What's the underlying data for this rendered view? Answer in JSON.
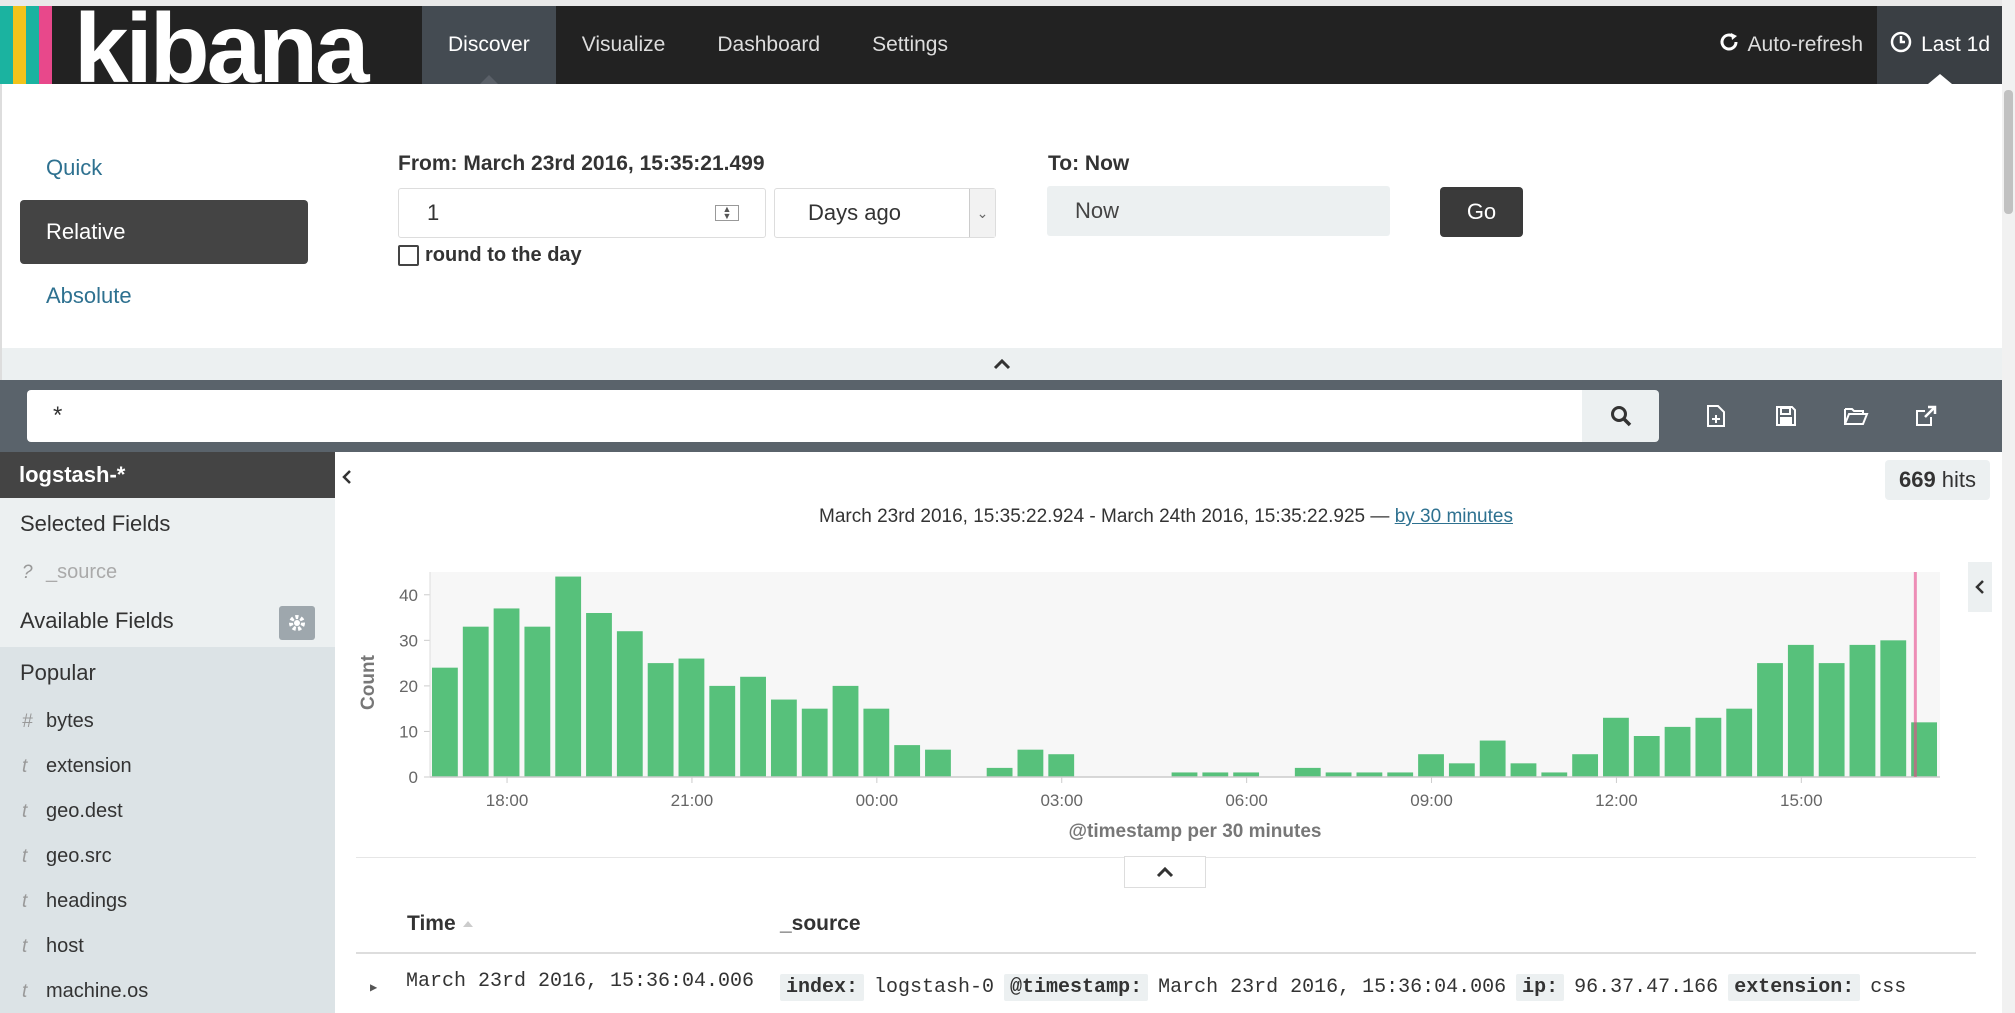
{
  "app": {
    "logo_text": "kibana",
    "logo_colors": [
      "#e8488b",
      "#f2c31a",
      "#1bb3a0",
      "#3ebeb0"
    ]
  },
  "nav": {
    "tabs": [
      {
        "label": "Discover",
        "active": true
      },
      {
        "label": "Visualize",
        "active": false
      },
      {
        "label": "Dashboard",
        "active": false
      },
      {
        "label": "Settings",
        "active": false
      }
    ],
    "auto_refresh": "Auto-refresh",
    "time_label": "Last 1d"
  },
  "timepicker": {
    "modes": [
      "Quick",
      "Relative",
      "Absolute"
    ],
    "active_mode": "Relative",
    "from_label": "From: March 23rd 2016, 15:35:21.499",
    "from_value": "1",
    "from_unit": "Days ago",
    "round_label": "round to the day",
    "to_label": "To: Now",
    "to_value": "Now",
    "go_label": "Go"
  },
  "search": {
    "query": "*"
  },
  "sidebar": {
    "index_pattern": "logstash-*",
    "selected_fields_label": "Selected Fields",
    "selected_fields": [
      {
        "type": "?",
        "name": "_source"
      }
    ],
    "available_fields_label": "Available Fields",
    "popular_label": "Popular",
    "popular_fields": [
      {
        "type": "#",
        "name": "bytes"
      },
      {
        "type": "t",
        "name": "extension"
      },
      {
        "type": "t",
        "name": "geo.dest"
      },
      {
        "type": "t",
        "name": "geo.src"
      },
      {
        "type": "t",
        "name": "headings"
      },
      {
        "type": "t",
        "name": "host"
      },
      {
        "type": "t",
        "name": "machine.os"
      }
    ]
  },
  "results": {
    "hits_count": "669",
    "hits_label": "hits",
    "range_text": "March 23rd 2016, 15:35:22.924 - March 24th 2016, 15:35:22.925 —",
    "interval_link": "by 30 minutes",
    "table_headers": {
      "time": "Time",
      "source": "_source"
    },
    "rows": [
      {
        "time": "March 23rd 2016, 15:36:04.006",
        "source": [
          {
            "key": "index:",
            "value": "logstash-0"
          },
          {
            "key": "@timestamp:",
            "value": "March 23rd 2016, 15:36:04.006"
          },
          {
            "key": "ip:",
            "value": "96.37.47.166"
          },
          {
            "key": "extension:",
            "value": "css"
          }
        ]
      }
    ]
  },
  "chart_data": {
    "type": "bar",
    "xlabel": "@timestamp per 30 minutes",
    "ylabel": "Count",
    "ylim": [
      0,
      45
    ],
    "yticks": [
      0,
      10,
      20,
      30,
      40
    ],
    "x_ticks": [
      "18:00",
      "21:00",
      "00:00",
      "03:00",
      "06:00",
      "09:00",
      "12:00",
      "15:00"
    ],
    "x_tick_index": [
      2.5,
      8.5,
      14.5,
      20.5,
      26.5,
      32.5,
      38.5,
      44.5
    ],
    "values": [
      24,
      33,
      37,
      33,
      44,
      36,
      32,
      25,
      26,
      20,
      22,
      17,
      15,
      20,
      15,
      7,
      6,
      0,
      2,
      6,
      5,
      0,
      0,
      0,
      1,
      1,
      1,
      0,
      2,
      1,
      1,
      1,
      5,
      3,
      8,
      3,
      1,
      5,
      13,
      9,
      11,
      13,
      15,
      25,
      29,
      25,
      29,
      30,
      12
    ],
    "color": "#57c17b",
    "now_marker_color": "#e8488b"
  }
}
